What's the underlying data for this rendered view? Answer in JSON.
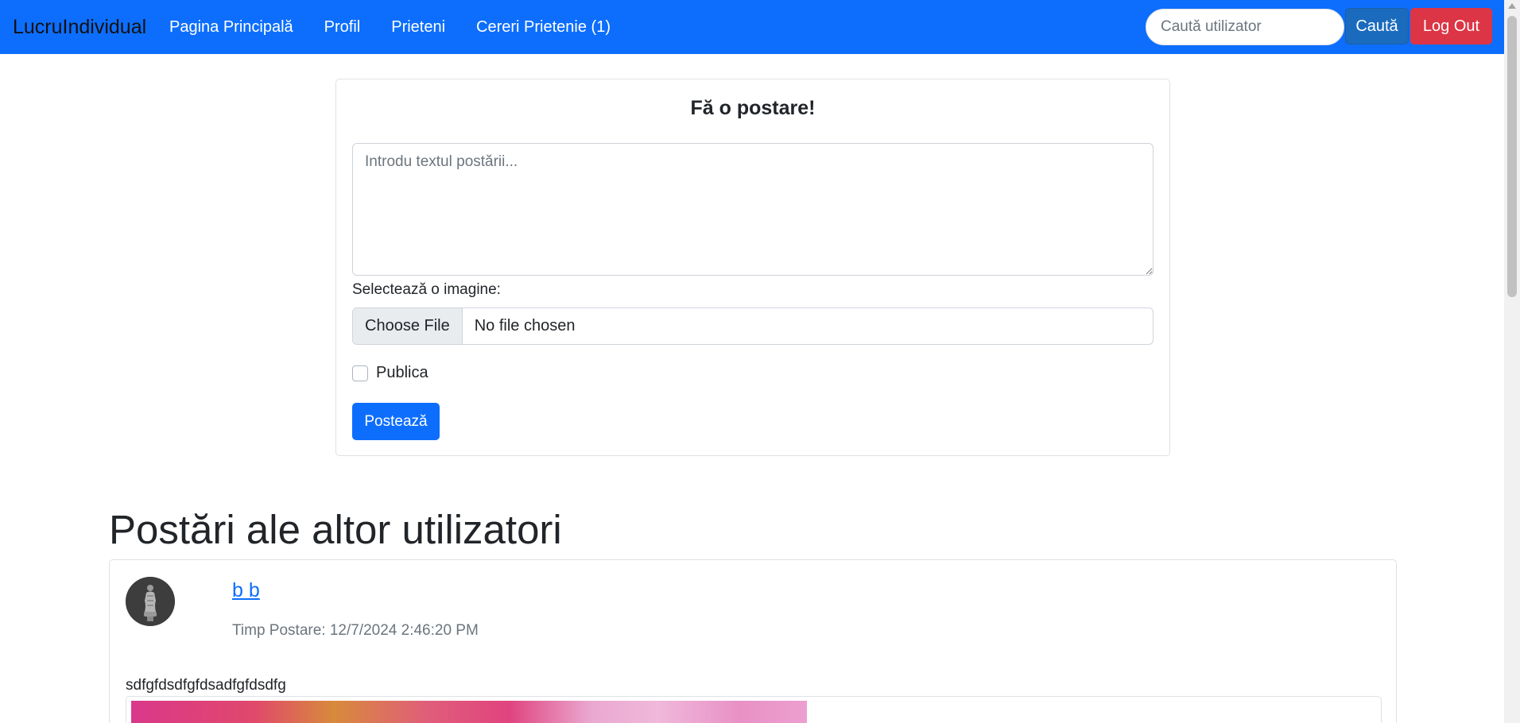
{
  "navbar": {
    "brand": "LucruIndividual",
    "links": [
      {
        "label": "Pagina Principală"
      },
      {
        "label": "Profil"
      },
      {
        "label": "Prieteni"
      },
      {
        "label": "Cereri Prietenie (1)"
      }
    ],
    "search_placeholder": "Caută utilizator",
    "search_button": "Caută",
    "logout_button": "Log Out"
  },
  "post_form": {
    "title": "Fă o postare!",
    "textarea_placeholder": "Introdu textul postării...",
    "image_label": "Selectează o imagine:",
    "file_button": "Choose File",
    "file_status": "No file chosen",
    "public_label": "Publica",
    "public_checked": false,
    "submit_button": "Postează"
  },
  "feed": {
    "heading": "Postări ale altor utilizatori",
    "posts": [
      {
        "author": "b b",
        "time": "Timp Postare: 12/7/2024 2:46:20 PM",
        "text": "sdfgfdsdfgfdsadfgfdsdfg"
      }
    ]
  },
  "colors": {
    "primary": "#0d6efd",
    "danger": "#dc3545",
    "search_button": "#1a6bbe"
  }
}
